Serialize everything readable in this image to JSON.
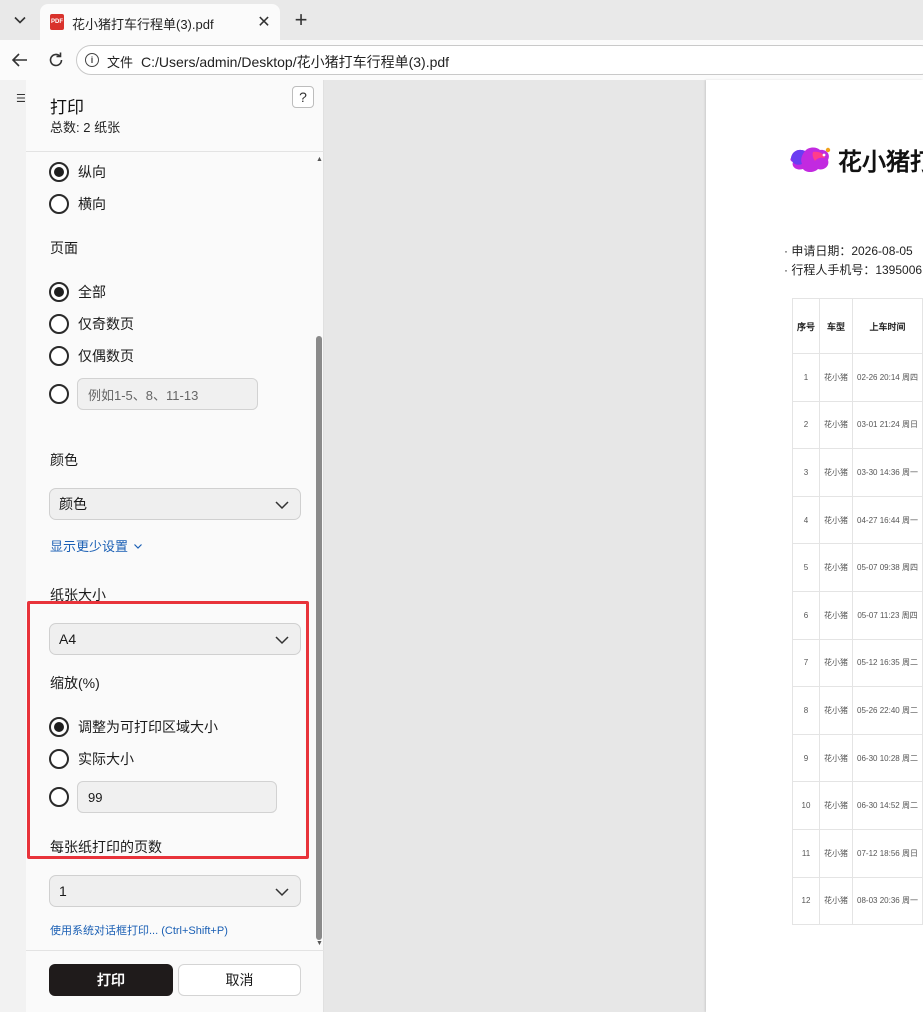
{
  "browser": {
    "tab": {
      "title": "花小猪打车行程单(3).pdf",
      "icon": "PDF"
    },
    "new_tab_symbol": "+",
    "close_symbol": "✕",
    "address": {
      "scheme_label": "文件",
      "url": "C:/Users/admin/Desktop/花小猪打车行程单(3).pdf"
    }
  },
  "print_dialog": {
    "title": "打印",
    "subtitle": "总数: 2 纸张",
    "help_symbol": "?",
    "orientation": {
      "options": [
        {
          "label": "纵向",
          "checked": true
        },
        {
          "label": "横向",
          "checked": false
        }
      ]
    },
    "pages": {
      "label": "页面",
      "options": [
        {
          "label": "全部",
          "checked": true
        },
        {
          "label": "仅奇数页",
          "checked": false
        },
        {
          "label": "仅偶数页",
          "checked": false
        }
      ],
      "custom_placeholder": "例如1-5、8、11-13"
    },
    "color": {
      "label": "颜色",
      "selected": "颜色"
    },
    "more_settings_link": "显示更少设置",
    "paper_size": {
      "label": "纸张大小",
      "selected": "A4"
    },
    "scale": {
      "label": "缩放(%)",
      "options": [
        {
          "label": "调整为可打印区域大小",
          "checked": true
        },
        {
          "label": "实际大小",
          "checked": false
        }
      ],
      "custom_value": "99"
    },
    "pages_per_sheet": {
      "label": "每张纸打印的页数",
      "selected": "1"
    },
    "system_dialog_link": "使用系统对话框打印... (Ctrl+Shift+P)",
    "print_button": "打印",
    "cancel_button": "取消",
    "highlight_color": "#e8333a"
  },
  "preview": {
    "logo_text": "花小猪打",
    "apply_date": "· 申请日期：2026-08-05",
    "phone_line": "· 行程人手机号：1395006",
    "table": {
      "headers": [
        "序号",
        "车型",
        "上车时间"
      ],
      "rows": [
        {
          "idx": "1",
          "car": "花小猪",
          "time": "02-26 20:14 周四"
        },
        {
          "idx": "2",
          "car": "花小猪",
          "time": "03-01 21:24 周日"
        },
        {
          "idx": "3",
          "car": "花小猪",
          "time": "03-30 14:36 周一"
        },
        {
          "idx": "4",
          "car": "花小猪",
          "time": "04-27 16:44 周一"
        },
        {
          "idx": "5",
          "car": "花小猪",
          "time": "05-07 09:38 周四"
        },
        {
          "idx": "6",
          "car": "花小猪",
          "time": "05-07 11:23 周四"
        },
        {
          "idx": "7",
          "car": "花小猪",
          "time": "05-12 16:35 周二"
        },
        {
          "idx": "8",
          "car": "花小猪",
          "time": "05-26 22:40 周二"
        },
        {
          "idx": "9",
          "car": "花小猪",
          "time": "06-30 10:28 周二"
        },
        {
          "idx": "10",
          "car": "花小猪",
          "time": "06-30 14:52 周二"
        },
        {
          "idx": "11",
          "car": "花小猪",
          "time": "07-12 18:56 周日"
        },
        {
          "idx": "12",
          "car": "花小猪",
          "time": "08-03 20:36 周一"
        }
      ]
    }
  }
}
